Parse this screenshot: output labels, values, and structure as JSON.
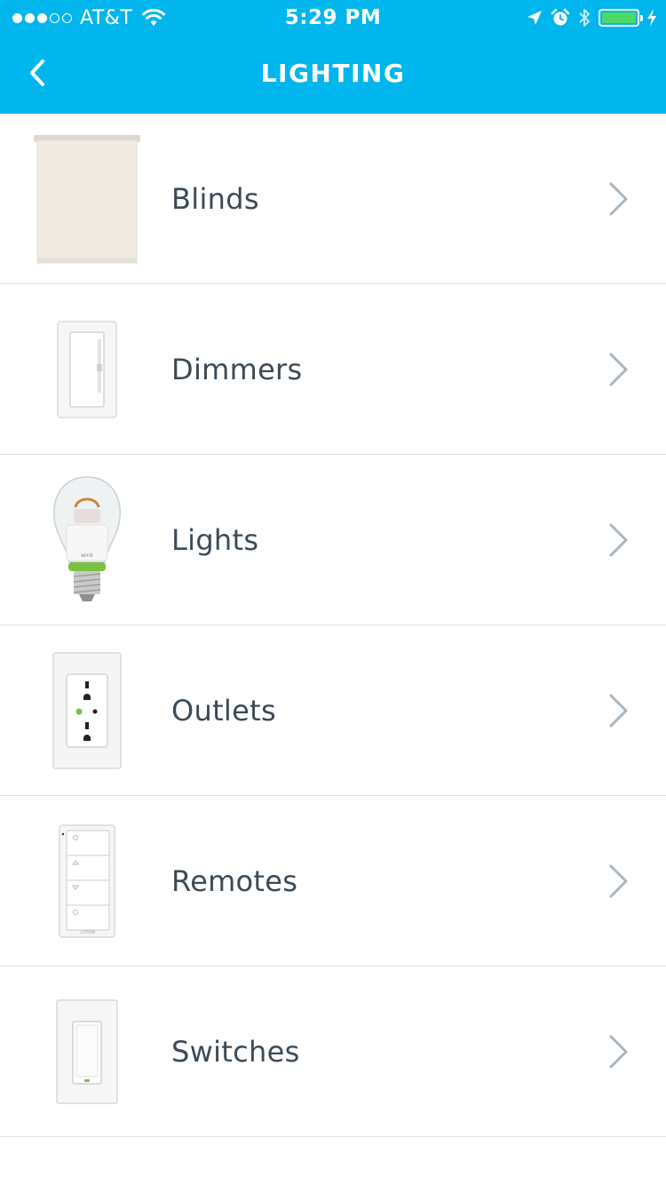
{
  "status_bar": {
    "signal_dots_filled": 3,
    "signal_dots_total": 5,
    "carrier": "AT&T",
    "time": "5:29 PM",
    "battery_level": 1.0,
    "battery_color": "#4cd964"
  },
  "nav": {
    "title": "LIGHTING",
    "back_icon": "chevron-left-icon",
    "background_color": "#00b6ed"
  },
  "items": [
    {
      "label": "Blinds",
      "icon": "blinds-image"
    },
    {
      "label": "Dimmers",
      "icon": "dimmer-image"
    },
    {
      "label": "Lights",
      "icon": "light-bulb-image"
    },
    {
      "label": "Outlets",
      "icon": "outlet-image"
    },
    {
      "label": "Remotes",
      "icon": "remote-image"
    },
    {
      "label": "Switches",
      "icon": "switch-image"
    }
  ]
}
